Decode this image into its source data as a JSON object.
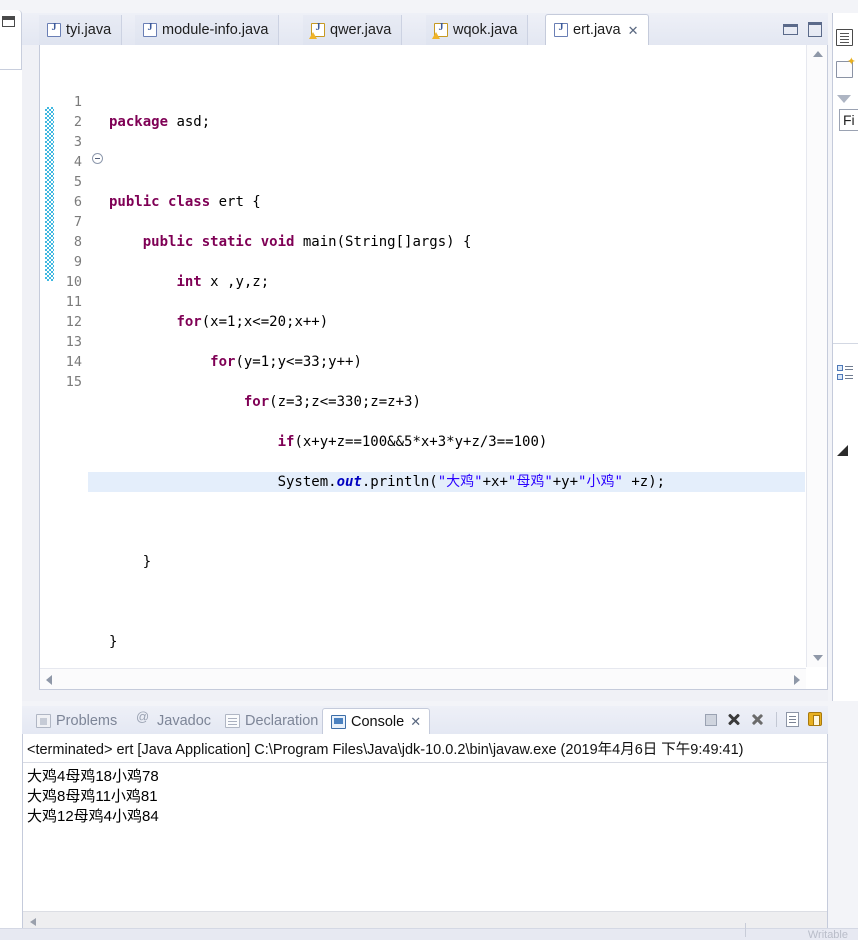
{
  "editor": {
    "tabs": [
      {
        "label": "tyi.java",
        "icon": "java-file-icon",
        "active": false,
        "warning": false
      },
      {
        "label": "module-info.java",
        "icon": "java-file-icon",
        "active": false,
        "warning": false
      },
      {
        "label": "qwer.java",
        "icon": "java-file-warning-icon",
        "active": false,
        "warning": true
      },
      {
        "label": "wqok.java",
        "icon": "java-file-warning-icon",
        "active": false,
        "warning": true
      },
      {
        "label": "ert.java",
        "icon": "java-file-icon",
        "active": true,
        "warning": false
      }
    ],
    "close_glyph": "✕",
    "window_controls": {
      "minimize": "minimize-icon",
      "maximize": "maximize-icon"
    },
    "line_numbers": [
      "1",
      "2",
      "3",
      "4",
      "5",
      "6",
      "7",
      "8",
      "9",
      "10",
      "11",
      "12",
      "13",
      "14",
      "15"
    ],
    "highlighted_line": 10,
    "fold_marker_line": 4,
    "code_lines": [
      {
        "n": 1,
        "text": "package asd;"
      },
      {
        "n": 2,
        "text": ""
      },
      {
        "n": 3,
        "text": "public class ert {"
      },
      {
        "n": 4,
        "text": "    public static void main(String[]args) {"
      },
      {
        "n": 5,
        "text": "        int x ,y,z;"
      },
      {
        "n": 6,
        "text": "        for(x=1;x<=20;x++)"
      },
      {
        "n": 7,
        "text": "            for(y=1;y<=33;y++)"
      },
      {
        "n": 8,
        "text": "                for(z=3;z<=330;z=z+3)"
      },
      {
        "n": 9,
        "text": "                    if(x+y+z==100&&5*x+3*y+z/3==100)"
      },
      {
        "n": 10,
        "text": "                    System.out.println(\"大鸡\"+x+\"母鸡\"+y+\"小鸡\" +z);"
      },
      {
        "n": 11,
        "text": ""
      },
      {
        "n": 12,
        "text": "    }"
      },
      {
        "n": 13,
        "text": ""
      },
      {
        "n": 14,
        "text": "}"
      },
      {
        "n": 15,
        "text": ""
      }
    ]
  },
  "bottom_panel": {
    "tabs": [
      {
        "label": "Problems",
        "icon": "problems-icon",
        "active": false
      },
      {
        "label": "Javadoc",
        "icon": "javadoc-icon",
        "active": false
      },
      {
        "label": "Declaration",
        "icon": "declaration-icon",
        "active": false
      },
      {
        "label": "Console",
        "icon": "console-icon",
        "active": true
      }
    ],
    "close_glyph": "✕",
    "toolbar": [
      {
        "name": "terminate-icon",
        "title": "Terminate"
      },
      {
        "name": "remove-launch-icon",
        "title": "Remove Launch"
      },
      {
        "name": "remove-all-terminated-icon",
        "title": "Remove All Terminated Launches"
      },
      {
        "name": "clear-console-icon",
        "title": "Clear Console"
      },
      {
        "name": "scroll-lock-icon",
        "title": "Scroll Lock"
      }
    ],
    "console": {
      "header": "<terminated> ert [Java Application] C:\\Program Files\\Java\\jdk-10.0.2\\bin\\javaw.exe (2019年4月6日 下午9:49:41)",
      "output": [
        "大鸡4母鸡18小鸡78",
        "大鸡8母鸡11小鸡81",
        "大鸡12母鸡4小鸡84"
      ]
    }
  },
  "right_panel": {
    "icons": [
      {
        "name": "view-menu-icon"
      },
      {
        "name": "new-task-icon"
      },
      {
        "name": "filter-icon"
      },
      {
        "name": "outline-icon"
      },
      {
        "name": "resize-handle-icon"
      }
    ],
    "find_field": {
      "value": "Fi",
      "placeholder": "Find"
    }
  },
  "left_panel": {
    "icon": "restore-view-icon"
  },
  "status_bar": {
    "text": "Writable"
  },
  "colors": {
    "keyword": "#7f0055",
    "string": "#2a00ff",
    "field": "#0000c0",
    "quickdiff": "#3fb8e0",
    "line_highlight": "#e4eefb",
    "tab_active_bg": "#ffffff",
    "chrome_bg": "#e4e8f3"
  }
}
